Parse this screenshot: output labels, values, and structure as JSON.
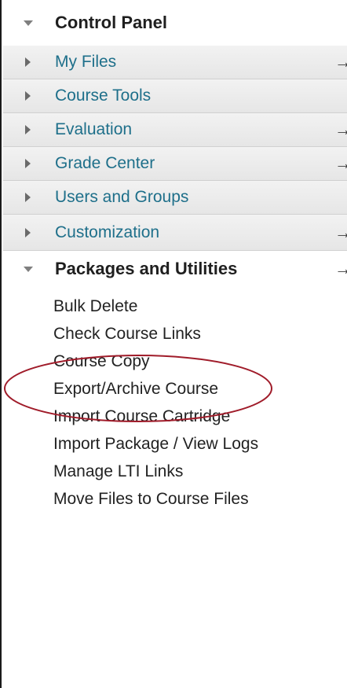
{
  "control_panel": {
    "title": "Control Panel"
  },
  "menu": [
    {
      "label": "My Files",
      "arrow": "→"
    },
    {
      "label": "Course Tools",
      "arrow": ""
    },
    {
      "label": "Evaluation",
      "arrow": "→"
    },
    {
      "label": "Grade Center",
      "arrow": "→"
    },
    {
      "label": "Users and Groups",
      "arrow": ""
    },
    {
      "label": "Customization",
      "arrow": "→"
    }
  ],
  "packages": {
    "title": "Packages and Utilities",
    "arrow": "→",
    "items": [
      "Bulk Delete",
      "Check Course Links",
      "Course Copy",
      "Export/Archive Course",
      "Import Course Cartridge",
      "Import Package / View Logs",
      "Manage LTI Links",
      "Move Files to Course Files"
    ]
  },
  "colors": {
    "link": "#1e6f8a",
    "highlight_ellipse": "#a01c2a"
  }
}
